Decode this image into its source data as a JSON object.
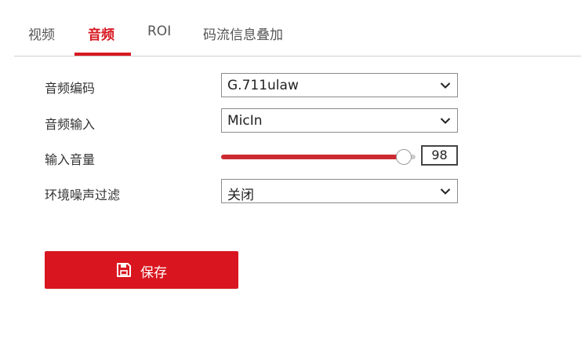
{
  "tabs": [
    {
      "label": "视频",
      "active": false
    },
    {
      "label": "音频",
      "active": true
    },
    {
      "label": "ROI",
      "active": false
    },
    {
      "label": "码流信息叠加",
      "active": false
    }
  ],
  "form": {
    "audio_encoding": {
      "label": "音频编码",
      "value": "G.711ulaw"
    },
    "audio_input": {
      "label": "音频输入",
      "value": "MicIn"
    },
    "input_volume": {
      "label": "输入音量",
      "value": "98",
      "level_percent": 98
    },
    "noise_filter": {
      "label": "环境噪声过滤",
      "value": "关闭"
    }
  },
  "save_button": {
    "label": "保存"
  },
  "colors": {
    "accent": "#d71920",
    "slider_fill": "#cc2a30",
    "button_bg": "#d9161f"
  },
  "icons": {
    "dropdown": "chevron-down-icon",
    "save": "floppy-disk-icon"
  }
}
